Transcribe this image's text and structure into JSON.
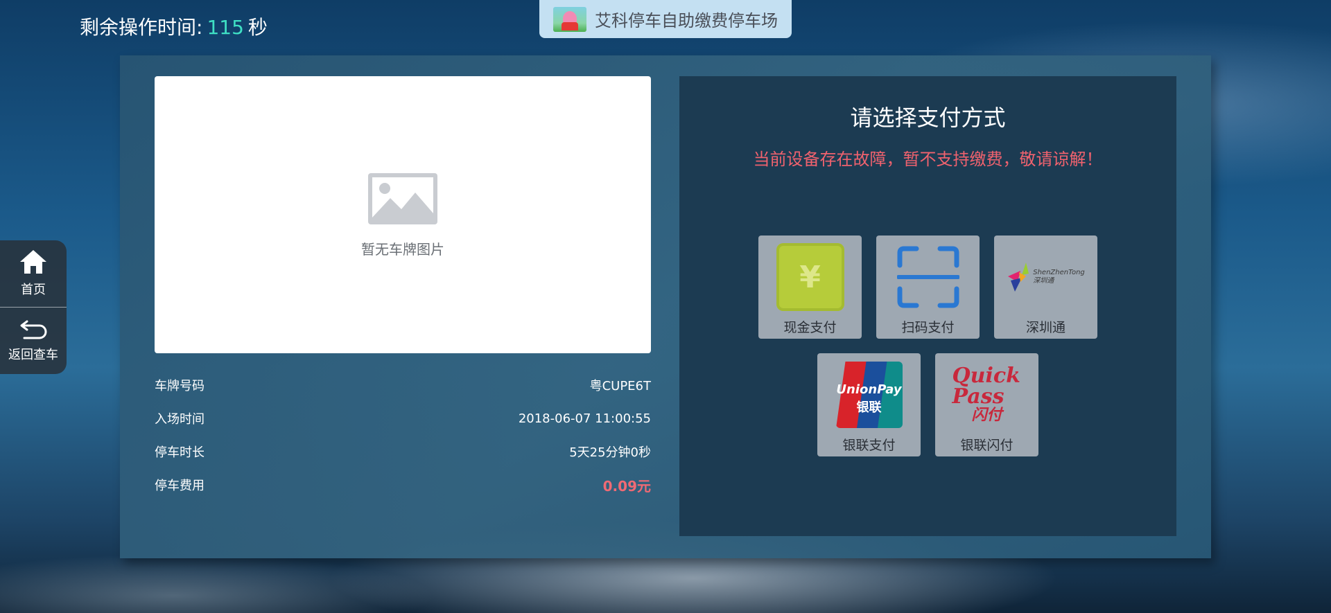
{
  "header": {
    "timer_label": "剩余操作时间:",
    "timer_value": "115",
    "timer_unit": "秒",
    "parking_lot_name": "艾科停车自助缴费停车场"
  },
  "side_nav": {
    "items": [
      {
        "label": "首页",
        "icon": "home-icon"
      },
      {
        "label": "返回查车",
        "icon": "return-icon"
      }
    ]
  },
  "plate_image": {
    "placeholder_text": "暂无车牌图片",
    "icon": "image-placeholder-icon"
  },
  "info": {
    "rows": [
      {
        "label": "车牌号码",
        "value": "粤CUPE6T"
      },
      {
        "label": "入场时间",
        "value": "2018-06-07 11:00:55"
      },
      {
        "label": "停车时长",
        "value": "5天25分钟0秒"
      },
      {
        "label": "停车费用",
        "value": "0.09元"
      }
    ]
  },
  "payment": {
    "title": "请选择支付方式",
    "warning": "当前设备存在故障，暂不支持缴费，敬请谅解！",
    "methods": [
      {
        "label": "现金支付",
        "icon": "cash-yen-icon"
      },
      {
        "label": "扫码支付",
        "icon": "scan-qr-icon"
      },
      {
        "label": "深圳通",
        "icon": "shenzhentong-logo-icon",
        "logo_text_en": "ShenZhenTong",
        "logo_text_cn": "深圳通"
      },
      {
        "label": "银联支付",
        "icon": "unionpay-logo-icon",
        "logo_text_en": "UnionPay",
        "logo_text_cn": "银联"
      },
      {
        "label": "银联闪付",
        "icon": "quickpass-logo-icon",
        "logo_text_en": "Quick Pass",
        "logo_text_cn": "闪付"
      }
    ]
  },
  "colors": {
    "timer_value": "#3fe0c4",
    "warning": "#f0626e",
    "fee": "#f06a74",
    "pay_panel_bg": "#1c3b52",
    "card_bg": "#9ea8b2"
  }
}
